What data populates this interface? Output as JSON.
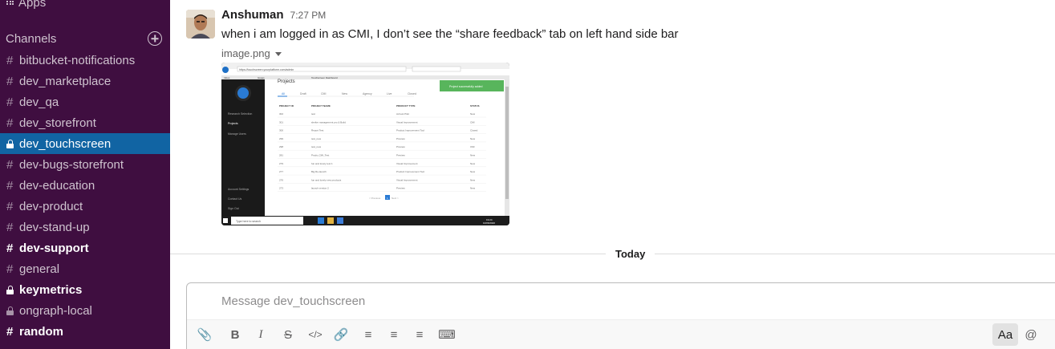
{
  "sidebar": {
    "apps_label": "Apps",
    "channels_title": "Channels",
    "channels": [
      {
        "name": "bitbucket-notifications",
        "private": false,
        "state": "normal"
      },
      {
        "name": "dev_marketplace",
        "private": false,
        "state": "normal"
      },
      {
        "name": "dev_qa",
        "private": false,
        "state": "normal"
      },
      {
        "name": "dev_storefront",
        "private": false,
        "state": "normal"
      },
      {
        "name": "dev_touchscreen",
        "private": true,
        "state": "active"
      },
      {
        "name": "dev-bugs-storefront",
        "private": false,
        "state": "normal"
      },
      {
        "name": "dev-education",
        "private": false,
        "state": "normal"
      },
      {
        "name": "dev-product",
        "private": false,
        "state": "normal"
      },
      {
        "name": "dev-stand-up",
        "private": false,
        "state": "normal"
      },
      {
        "name": "dev-support",
        "private": false,
        "state": "unread"
      },
      {
        "name": "general",
        "private": false,
        "state": "normal"
      },
      {
        "name": "keymetrics",
        "private": true,
        "state": "unread"
      },
      {
        "name": "ongraph-local",
        "private": true,
        "state": "normal"
      },
      {
        "name": "random",
        "private": false,
        "state": "unread"
      }
    ]
  },
  "message": {
    "author": "Anshuman",
    "time": "7:27 PM",
    "text": "when i am logged in as CMI, I don’t see the “share feedback” tab on left hand side bar",
    "attachment_name": "image.png"
  },
  "divider": {
    "label": "Today"
  },
  "composer": {
    "placeholder": "Message dev_touchscreen",
    "toolbar": [
      {
        "icon": "paperclip-icon",
        "glyph": "📎"
      },
      {
        "icon": "bold-icon",
        "glyph": "B"
      },
      {
        "icon": "italic-icon",
        "glyph": "I"
      },
      {
        "icon": "strikethrough-icon",
        "glyph": "S"
      },
      {
        "icon": "code-icon",
        "glyph": "</>"
      },
      {
        "icon": "link-icon",
        "glyph": "🔗"
      },
      {
        "icon": "ordered-list-icon",
        "glyph": "≡"
      },
      {
        "icon": "bulleted-list-icon",
        "glyph": "≡"
      },
      {
        "icon": "blockquote-icon",
        "glyph": "≡"
      },
      {
        "icon": "code-block-icon",
        "glyph": "⌨"
      }
    ],
    "right_toolbar": [
      {
        "icon": "formatting-toggle-icon",
        "glyph": "Aa"
      },
      {
        "icon": "mention-icon",
        "glyph": "@"
      }
    ]
  },
  "screenshot": {
    "browser_url": "https://touchscreen.yourplatform.com/admin",
    "tabs": [
      "Inbox",
      "Issues",
      "Touchscreen Dashboard"
    ],
    "title": "Projects",
    "toast": "Project successfully added",
    "sidebar_items": [
      "Research Selection",
      "Projects",
      "Manage Users"
    ],
    "sidebar_bottom": [
      "Account Settings",
      "Contact Us",
      "Sign Out"
    ],
    "filter_tabs": [
      "All",
      "Draft",
      "CMI",
      "New",
      "Agency",
      "Live",
      "Closed"
    ],
    "columns": [
      "PROJECT ID",
      "PROJECT NAME",
      "PRODUCT TYPE",
      "STATUS"
    ],
    "rows": [
      [
        "302",
        "test",
        "Ad test Pilot",
        "New"
      ],
      [
        "301",
        "shelter management pro & Build",
        "Visual Improvement",
        "CMI"
      ],
      [
        "300",
        "Report Test",
        "Product Improvement Tool",
        "Closed"
      ],
      [
        "299",
        "test_new",
        "Preview",
        "New"
      ],
      [
        "298",
        "test_new",
        "Preview",
        "CMI"
      ],
      [
        "281",
        "Prods_CMI_Test",
        "Preview",
        "New"
      ],
      [
        "279",
        "fun and lovely test 1",
        "Visual Improvement",
        "New"
      ],
      [
        "277",
        "Big Re-launch",
        "Product Improvement Tool",
        "New"
      ],
      [
        "276",
        "fun and lovely new products",
        "Visual Improvement",
        "New"
      ],
      [
        "273",
        "launch version 2",
        "Preview",
        "New"
      ]
    ],
    "pagination": [
      "< Previous",
      "1",
      "Next >"
    ],
    "taskbar_search": "Type here to search",
    "taskbar_time": "19:24",
    "taskbar_date": "10/06/2020"
  }
}
